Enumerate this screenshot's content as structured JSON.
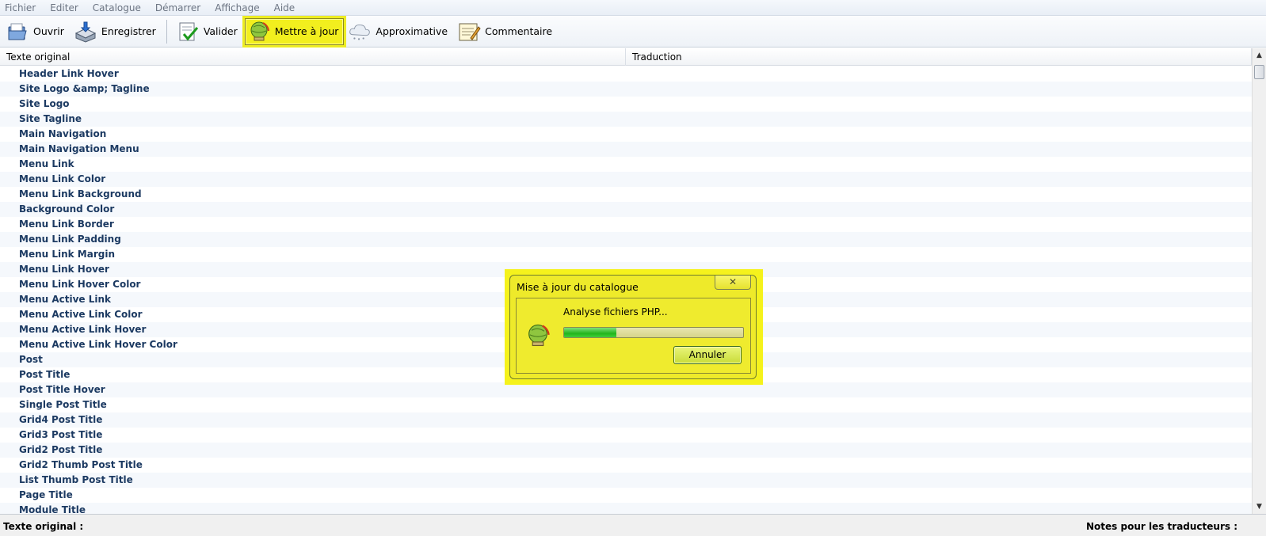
{
  "menu": [
    "Fichier",
    "Editer",
    "Catalogue",
    "Démarrer",
    "Affichage",
    "Aide"
  ],
  "toolbar": {
    "open": {
      "label": "Ouvrir",
      "icon": "folder-open-icon"
    },
    "save": {
      "label": "Enregistrer",
      "icon": "save-disk-icon"
    },
    "validate": {
      "label": "Valider",
      "icon": "validate-check-icon"
    },
    "update": {
      "label": "Mettre à jour",
      "icon": "update-globe-icon"
    },
    "fuzzy": {
      "label": "Approximative",
      "icon": "fuzzy-cloud-icon"
    },
    "comment": {
      "label": "Commentaire",
      "icon": "comment-notepad-icon"
    }
  },
  "columns": {
    "original": "Texte original",
    "translation": "Traduction"
  },
  "rows": [
    "Header Link Hover",
    "Site Logo &amp; Tagline",
    "Site Logo",
    "Site Tagline",
    "Main Navigation",
    "Main Navigation Menu",
    "Menu Link",
    "Menu Link Color",
    "Menu Link Background",
    "Background Color",
    "Menu Link Border",
    "Menu Link Padding",
    "Menu Link Margin",
    "Menu Link Hover",
    "Menu Link Hover Color",
    "Menu Active Link",
    "Menu Active Link Color",
    "Menu Active Link Hover",
    "Menu Active Link Hover Color",
    "Post",
    "Post Title",
    "Post Title Hover",
    "Single Post Title",
    "Grid4 Post Title",
    "Grid3 Post Title",
    "Grid2 Post Title",
    "Grid2 Thumb Post Title",
    "List Thumb Post Title",
    "Page Title",
    "Module Title"
  ],
  "status": {
    "left": "Texte original :",
    "right": "Notes pour les traducteurs :"
  },
  "dialog": {
    "title": "Mise à jour du catalogue",
    "message": "Analyse fichiers PHP...",
    "progress": 0.29,
    "cancel": "Annuler",
    "close": "✕"
  },
  "colors": {
    "highlight": "#f2ef1e",
    "row_text": "#1c3a62",
    "progress": "#22b51c"
  }
}
